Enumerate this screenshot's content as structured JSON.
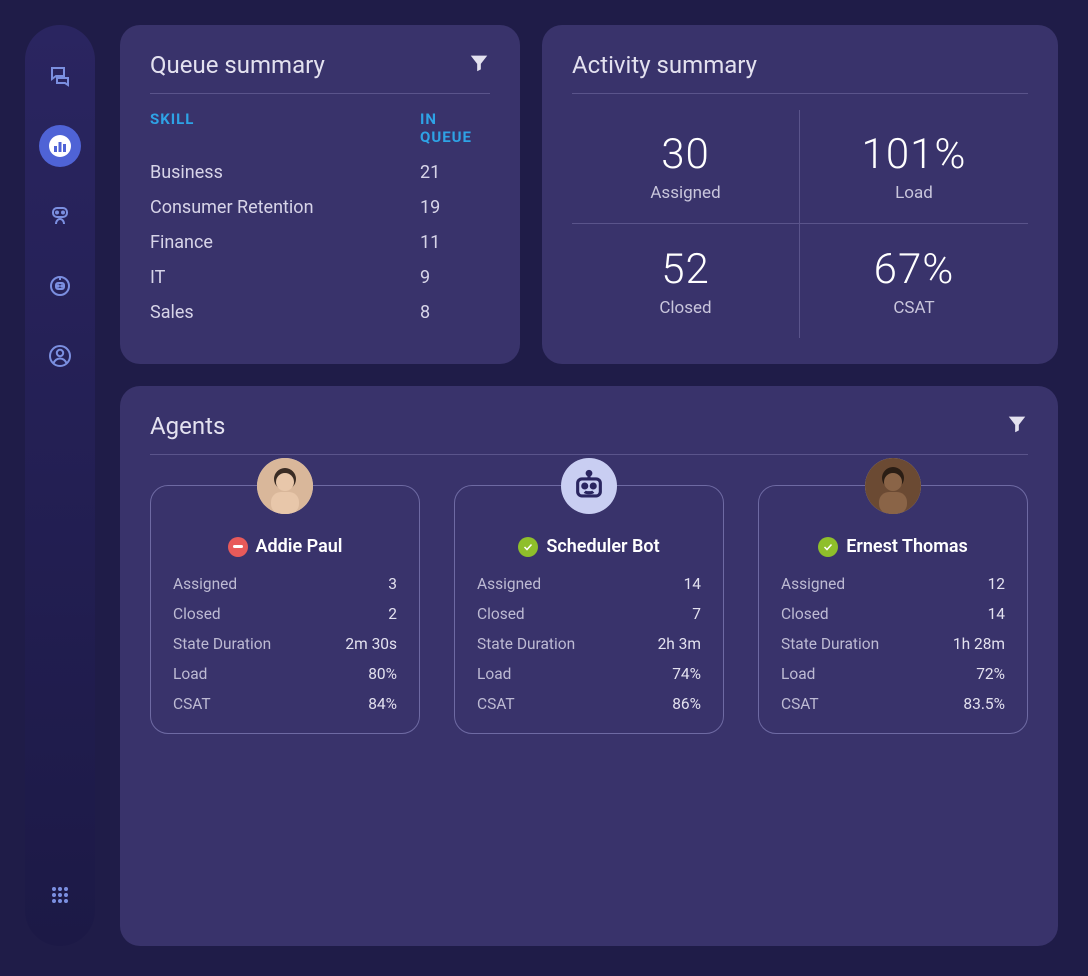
{
  "sidebar": {
    "icons": [
      "chat-icon",
      "analytics-icon",
      "bot-user-icon",
      "bot-settings-icon",
      "profile-icon",
      "apps-icon"
    ]
  },
  "queue": {
    "title": "Queue summary",
    "headers": {
      "skill": "SKILL",
      "inQueue": "IN QUEUE"
    },
    "rows": [
      {
        "skill": "Business",
        "count": "21"
      },
      {
        "skill": "Consumer Retention",
        "count": "19"
      },
      {
        "skill": "Finance",
        "count": "11"
      },
      {
        "skill": "IT",
        "count": "9"
      },
      {
        "skill": "Sales",
        "count": "8"
      }
    ]
  },
  "activity": {
    "title": "Activity summary",
    "metrics": [
      {
        "value": "30",
        "label": "Assigned"
      },
      {
        "value": "101%",
        "label": "Load"
      },
      {
        "value": "52",
        "label": "Closed"
      },
      {
        "value": "67%",
        "label": "CSAT"
      }
    ]
  },
  "agents": {
    "title": "Agents",
    "statLabels": {
      "assigned": "Assigned",
      "closed": "Closed",
      "stateDuration": "State Duration",
      "load": "Load",
      "csat": "CSAT"
    },
    "list": [
      {
        "name": "Addie Paul",
        "status": "away",
        "type": "human",
        "assigned": "3",
        "closed": "2",
        "stateDuration": "2m 30s",
        "load": "80%",
        "csat": "84%"
      },
      {
        "name": "Scheduler Bot",
        "status": "online",
        "type": "bot",
        "assigned": "14",
        "closed": "7",
        "stateDuration": "2h 3m",
        "load": "74%",
        "csat": "86%"
      },
      {
        "name": "Ernest Thomas",
        "status": "online",
        "type": "human",
        "assigned": "12",
        "closed": "14",
        "stateDuration": "1h 28m",
        "load": "72%",
        "csat": "83.5%"
      }
    ]
  }
}
